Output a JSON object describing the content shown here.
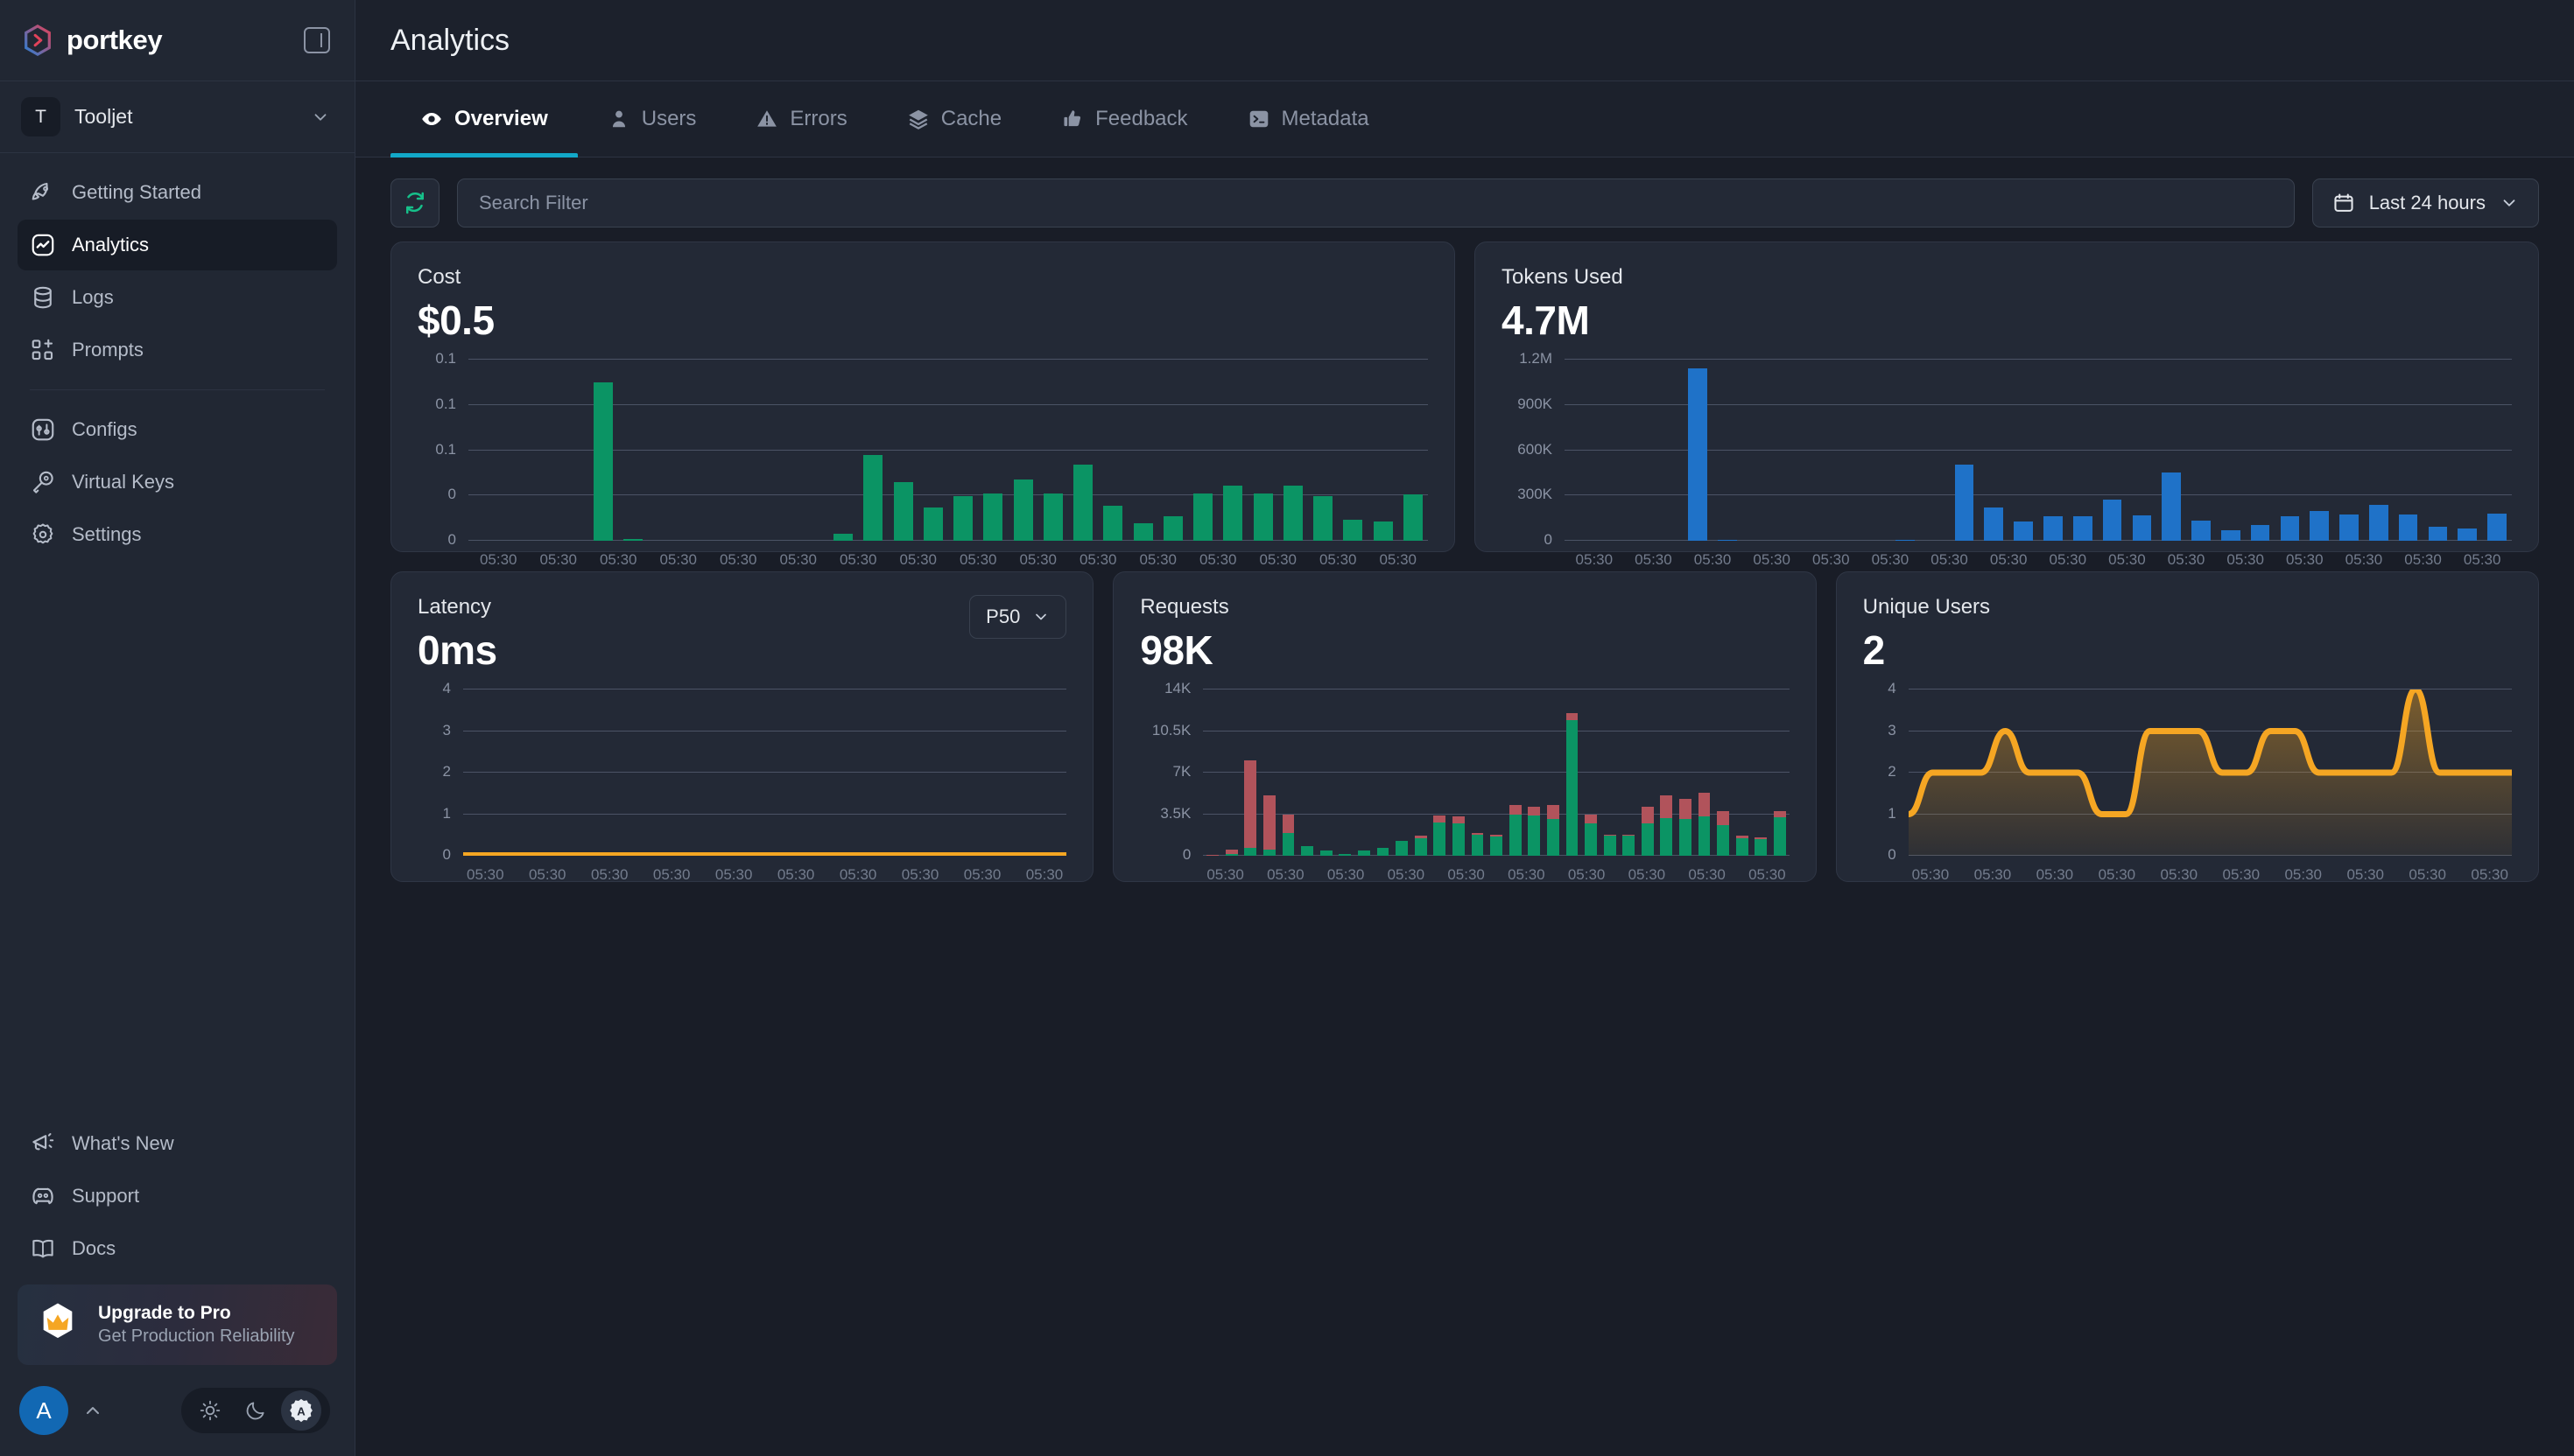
{
  "brand": {
    "name": "portkey",
    "collapse_icon": "panel-collapse-icon"
  },
  "org": {
    "initial": "T",
    "name": "Tooljet",
    "chevron": "chevron-down-icon"
  },
  "sidebar": {
    "primary_items": [
      {
        "label": "Getting Started",
        "icon": "rocket-icon",
        "active": false
      },
      {
        "label": "Analytics",
        "icon": "activity-icon",
        "active": true
      },
      {
        "label": "Logs",
        "icon": "database-icon",
        "active": false
      },
      {
        "label": "Prompts",
        "icon": "prompts-icon",
        "active": false
      }
    ],
    "secondary_items": [
      {
        "label": "Configs",
        "icon": "sliders-icon",
        "active": false
      },
      {
        "label": "Virtual Keys",
        "icon": "key-icon",
        "active": false
      },
      {
        "label": "Settings",
        "icon": "gear-icon",
        "active": false
      }
    ],
    "bottom_items": [
      {
        "label": "What's New",
        "icon": "megaphone-icon"
      },
      {
        "label": "Support",
        "icon": "discord-icon"
      },
      {
        "label": "Docs",
        "icon": "book-icon"
      }
    ],
    "upsell": {
      "title": "Upgrade to Pro",
      "subtitle": "Get Production Reliability",
      "icon": "crown-badge-icon"
    },
    "footer": {
      "avatar_initial": "A",
      "caret": "chevron-up-icon",
      "theme_options": [
        "light-mode-icon",
        "dark-mode-icon",
        "auto-mode-icon"
      ],
      "theme_selected": "auto-mode-icon"
    }
  },
  "header": {
    "title": "Analytics"
  },
  "tabs": [
    {
      "label": "Overview",
      "icon": "eye-icon",
      "active": true
    },
    {
      "label": "Users",
      "icon": "user-icon",
      "active": false
    },
    {
      "label": "Errors",
      "icon": "alert-triangle-icon",
      "active": false
    },
    {
      "label": "Cache",
      "icon": "layers-icon",
      "active": false
    },
    {
      "label": "Feedback",
      "icon": "thumbs-up-icon",
      "active": false
    },
    {
      "label": "Metadata",
      "icon": "terminal-icon",
      "active": false
    }
  ],
  "toolbar": {
    "refresh_icon": "refresh-icon",
    "search_placeholder": "Search Filter",
    "search_value": "",
    "daterange_label": "Last 24 hours",
    "daterange_icon": "calendar-icon",
    "daterange_chevron": "chevron-down-icon"
  },
  "colors": {
    "green": "#0b9464",
    "blue": "#1f72c8",
    "red": "#b1535b",
    "orange": "#f5a623",
    "accent": "#12a8c8",
    "card_bg": "#232936",
    "page_bg": "#191d27",
    "sidebar_bg": "#212733"
  },
  "cards": {
    "cost": {
      "title": "Cost",
      "value": "$0.5"
    },
    "tokens": {
      "title": "Tokens Used",
      "value": "4.7M"
    },
    "latency": {
      "title": "Latency",
      "value": "0ms",
      "percentile": "P50",
      "percentile_chevron": "chevron-down-icon"
    },
    "requests": {
      "title": "Requests",
      "value": "98K"
    },
    "users": {
      "title": "Unique Users",
      "value": "2"
    }
  },
  "chart_data": [
    {
      "id": "cost",
      "type": "bar",
      "title": "Cost",
      "xlabel": "",
      "ylabel": "",
      "ylim": [
        0,
        0.1
      ],
      "grid": true,
      "yticks": [
        "0",
        "0",
        "0.1",
        "0.1",
        "0.1"
      ],
      "ytick_values": [
        0,
        0.025,
        0.05,
        0.075,
        0.1
      ],
      "xticks": [
        "05:30",
        "05:30",
        "05:30",
        "05:30",
        "05:30",
        "05:30",
        "05:30",
        "05:30",
        "05:30",
        "05:30",
        "05:30",
        "05:30",
        "05:30",
        "05:30",
        "05:30",
        "05:30"
      ],
      "color": "#0b9464",
      "values": [
        0,
        0,
        0,
        0,
        0.0875,
        0.0008,
        0,
        0,
        0,
        0,
        0,
        0,
        0.004,
        0.0475,
        0.0325,
        0.0185,
        0.0245,
        0.026,
        0.034,
        0.026,
        0.042,
        0.0195,
        0.0095,
        0.0135,
        0.026,
        0.0305,
        0.026,
        0.0305,
        0.0245,
        0.0115,
        0.0105,
        0.0255
      ]
    },
    {
      "id": "tokens",
      "type": "bar",
      "title": "Tokens Used",
      "xlabel": "",
      "ylabel": "",
      "ylim": [
        0,
        1200000
      ],
      "grid": true,
      "yticks": [
        "0",
        "300K",
        "600K",
        "900K",
        "1.2M"
      ],
      "ytick_values": [
        0,
        300000,
        600000,
        900000,
        1200000
      ],
      "xticks": [
        "05:30",
        "05:30",
        "05:30",
        "05:30",
        "05:30",
        "05:30",
        "05:30",
        "05:30",
        "05:30",
        "05:30",
        "05:30",
        "05:30",
        "05:30",
        "05:30",
        "05:30",
        "05:30"
      ],
      "color": "#1f72c8",
      "values": [
        0,
        0,
        0,
        0,
        1145000,
        8000,
        0,
        0,
        0,
        0,
        0,
        5000,
        0,
        505000,
        220000,
        125000,
        160000,
        165000,
        270000,
        167000,
        455000,
        135000,
        72000,
        105000,
        160000,
        195000,
        175000,
        240000,
        172000,
        90000,
        80000,
        180000
      ]
    },
    {
      "id": "latency",
      "type": "line",
      "title": "Latency",
      "xlabel": "",
      "ylabel": "",
      "ylim": [
        0,
        4
      ],
      "grid": true,
      "yticks": [
        "0",
        "1",
        "2",
        "3",
        "4"
      ],
      "ytick_values": [
        0,
        1,
        2,
        3,
        4
      ],
      "xticks": [
        "05:30",
        "05:30",
        "05:30",
        "05:30",
        "05:30",
        "05:30",
        "05:30",
        "05:30",
        "05:30",
        "05:30"
      ],
      "color": "#f5a623",
      "values": [
        0,
        0,
        0,
        0,
        0,
        0,
        0,
        0,
        0,
        0,
        0,
        0,
        0,
        0,
        0,
        0,
        0,
        0,
        0,
        0,
        0,
        0,
        0,
        0,
        0,
        0,
        0,
        0,
        0,
        0,
        0,
        0
      ]
    },
    {
      "id": "requests",
      "type": "bar",
      "title": "Requests",
      "stacked": true,
      "xlabel": "",
      "ylabel": "",
      "ylim": [
        0,
        14000
      ],
      "grid": true,
      "yticks": [
        "0",
        "3.5K",
        "7K",
        "10.5K",
        "14K"
      ],
      "ytick_values": [
        0,
        3500,
        7000,
        10500,
        14000
      ],
      "xticks": [
        "05:30",
        "05:30",
        "05:30",
        "05:30",
        "05:30",
        "05:30",
        "05:30",
        "05:30",
        "05:30",
        "05:30"
      ],
      "series": [
        {
          "name": "success",
          "color": "#0b9464",
          "values": [
            0,
            120,
            700,
            550,
            1900,
            800,
            480,
            150,
            480,
            700,
            1250,
            1500,
            2800,
            2750,
            1750,
            1650,
            3450,
            3400,
            3100,
            11400,
            2700,
            1700,
            1700,
            2750,
            3150,
            3100,
            3350,
            2550,
            1500,
            1400,
            3250
          ]
        },
        {
          "name": "error",
          "color": "#b1535b",
          "values": [
            50,
            400,
            7300,
            4500,
            1600,
            0,
            0,
            0,
            0,
            0,
            0,
            200,
            600,
            600,
            150,
            100,
            800,
            700,
            1200,
            600,
            750,
            100,
            100,
            1400,
            1950,
            1700,
            1950,
            1200,
            200,
            150,
            500
          ]
        }
      ]
    },
    {
      "id": "unique_users",
      "type": "area",
      "title": "Unique Users",
      "xlabel": "",
      "ylabel": "",
      "ylim": [
        0,
        4
      ],
      "grid": true,
      "yticks": [
        "0",
        "1",
        "2",
        "3",
        "4"
      ],
      "ytick_values": [
        0,
        1,
        2,
        3,
        4
      ],
      "xticks": [
        "05:30",
        "05:30",
        "05:30",
        "05:30",
        "05:30",
        "05:30",
        "05:30",
        "05:30",
        "05:30",
        "05:30"
      ],
      "color": "#f5a623",
      "values": [
        1,
        2,
        2,
        2,
        3,
        2,
        2,
        2,
        1,
        1,
        3,
        3,
        3,
        2,
        2,
        3,
        3,
        2,
        2,
        2,
        2,
        4,
        2,
        2,
        2,
        2
      ]
    }
  ]
}
